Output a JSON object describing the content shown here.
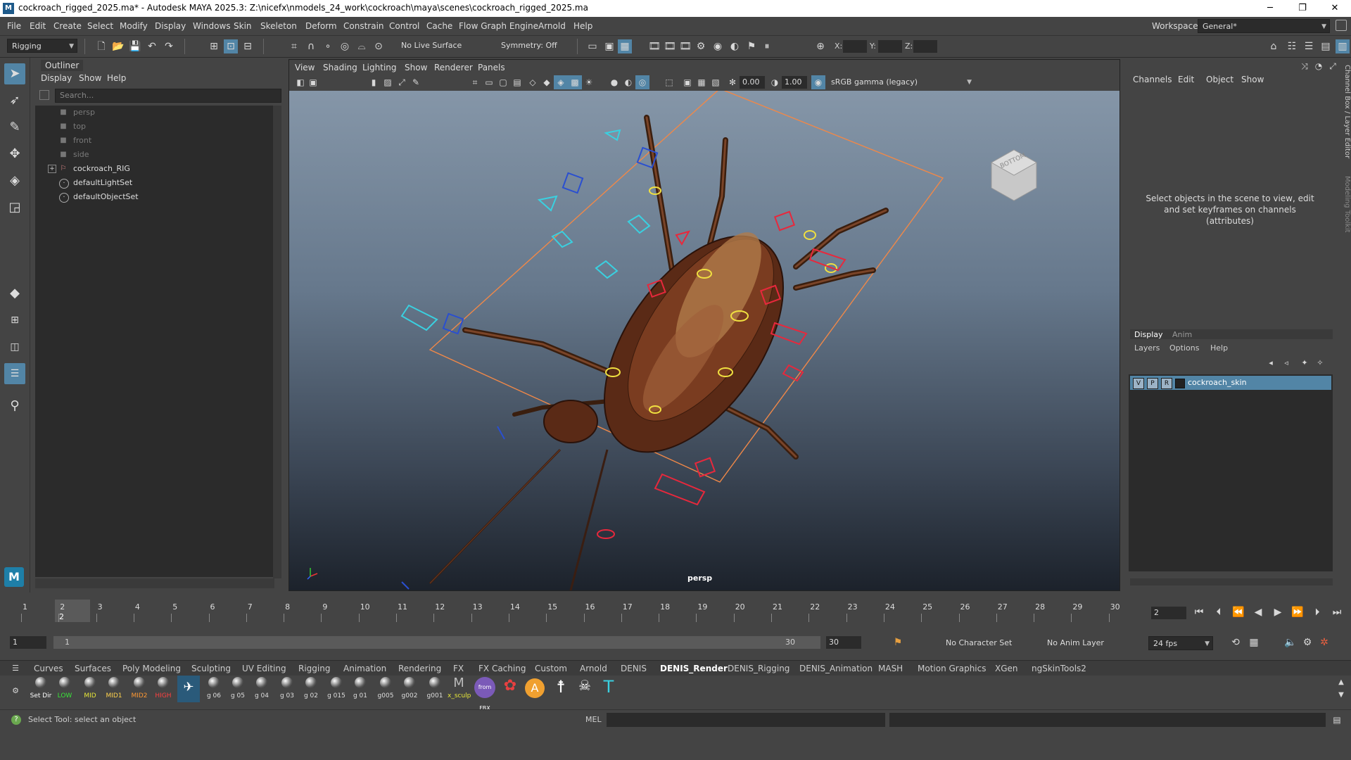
{
  "window": {
    "title": "cockroach_rigged_2025.ma* - Autodesk MAYA 2025.3: Z:\\nicefx\\nmodels_24_work\\cockroach\\maya\\scenes\\cockroach_rigged_2025.ma",
    "minimize": "─",
    "maximize": "❐",
    "close": "✕"
  },
  "menubar": {
    "items": [
      "File",
      "Edit",
      "Create",
      "Select",
      "Modify",
      "Display",
      "Windows",
      "Skin",
      "Skeleton",
      "Deform",
      "Constrain",
      "Control",
      "Cache",
      "Flow Graph Engine",
      "Arnold",
      "Help"
    ],
    "workspace_label": "Workspace:",
    "workspace_value": "General*"
  },
  "statusline": {
    "menuset": "Rigging",
    "live_surface": "No Live Surface",
    "symmetry": "Symmetry: Off",
    "x_label": "X:",
    "y_label": "Y:",
    "z_label": "Z:"
  },
  "outliner": {
    "title": "Outliner",
    "menu": [
      "Display",
      "Show",
      "Help"
    ],
    "search_placeholder": "Search...",
    "items": [
      {
        "label": "persp",
        "icon": "camera-icon",
        "dim": true
      },
      {
        "label": "top",
        "icon": "camera-icon",
        "dim": true
      },
      {
        "label": "front",
        "icon": "camera-icon",
        "dim": true
      },
      {
        "label": "side",
        "icon": "camera-icon",
        "dim": true
      },
      {
        "label": "cockroach_RIG",
        "icon": "transform-icon",
        "dim": false
      },
      {
        "label": "defaultLightSet",
        "icon": "set-icon",
        "dim": false
      },
      {
        "label": "defaultObjectSet",
        "icon": "set-icon",
        "dim": false
      }
    ]
  },
  "viewport": {
    "menu": [
      "View",
      "Shading",
      "Lighting",
      "Show",
      "Renderer",
      "Panels"
    ],
    "exposure": "0.00",
    "gamma": "1.00",
    "color_space": "sRGB gamma (legacy)",
    "camera_label": "persp",
    "viewcube_face": "BOTTOM"
  },
  "channelbox": {
    "menu": [
      "Channels",
      "Edit",
      "Object",
      "Show"
    ],
    "message": "Select objects in the scene to view, edit and set keyframes on channels (attributes)",
    "side_tab_1": "Channel Box / Layer Editor",
    "side_tab_2": "Modeling Toolkit",
    "layer_tabs": [
      "Display",
      "Anim"
    ],
    "layer_menu": [
      "Layers",
      "Options",
      "Help"
    ],
    "layer": {
      "v": "V",
      "p": "P",
      "r": "R",
      "name": "cockroach_skin"
    }
  },
  "timeslider": {
    "ticks": [
      "1",
      "2",
      "3",
      "4",
      "5",
      "6",
      "7",
      "8",
      "9",
      "10",
      "11",
      "12",
      "13",
      "14",
      "15",
      "16",
      "17",
      "18",
      "19",
      "20",
      "21",
      "22",
      "23",
      "24",
      "25",
      "26",
      "27",
      "28",
      "29",
      "30"
    ],
    "current_frame_label": "2",
    "current_frame_field": "2",
    "current_frame": 2,
    "range_start": "1",
    "range_inner_start": "1",
    "range_inner_end": "30",
    "range_end": "30",
    "character_set": "No Character Set",
    "anim_layer": "No Anim Layer",
    "fps": "24 fps"
  },
  "shelf": {
    "tabs": [
      "Curves",
      "Surfaces",
      "Poly Modeling",
      "Sculpting",
      "UV Editing",
      "Rigging",
      "Animation",
      "Rendering",
      "FX",
      "FX Caching",
      "Custom",
      "Arnold",
      "DENIS",
      "DENIS_Render",
      "DENIS_Rigging",
      "DENIS_Animation",
      "MASH",
      "Motion Graphics",
      "XGen",
      "ngSkinTools2"
    ],
    "active_tab": "DENIS_Render",
    "buttons": [
      {
        "label": "Set Dir",
        "color": "#ffffff"
      },
      {
        "label": "LOW",
        "color": "#39e639"
      },
      {
        "label": "MID",
        "color": "#e6e639"
      },
      {
        "label": "MID1",
        "color": "#ffd24d"
      },
      {
        "label": "MID2",
        "color": "#ff9933"
      },
      {
        "label": "HIGH",
        "color": "#ff4040"
      },
      {
        "label": "",
        "color": "#ffffff"
      },
      {
        "label": "g 06",
        "color": "#dddddd"
      },
      {
        "label": "g 05",
        "color": "#dddddd"
      },
      {
        "label": "g 04",
        "color": "#dddddd"
      },
      {
        "label": "g 03",
        "color": "#dddddd"
      },
      {
        "label": "g 02",
        "color": "#dddddd"
      },
      {
        "label": "g 015",
        "color": "#dddddd"
      },
      {
        "label": "g 01",
        "color": "#dddddd"
      },
      {
        "label": "g005",
        "color": "#dddddd"
      },
      {
        "label": "g002",
        "color": "#dddddd"
      },
      {
        "label": "g001",
        "color": "#dddddd"
      },
      {
        "label": "x_sculp",
        "color": "#e6e639"
      }
    ],
    "fbx_label": "from FBX",
    "arnold_letter": "A"
  },
  "helpline": {
    "message": "Select Tool: select an object",
    "mel_label": "MEL"
  },
  "colors": {
    "accent": "#5285a6",
    "panel_bg": "#444444",
    "field_bg": "#2b2b2b",
    "control_cyan": "#3ad0e0",
    "control_red": "#e8283c",
    "control_blue": "#2a4fd0",
    "bbox_orange": "#f08848"
  }
}
